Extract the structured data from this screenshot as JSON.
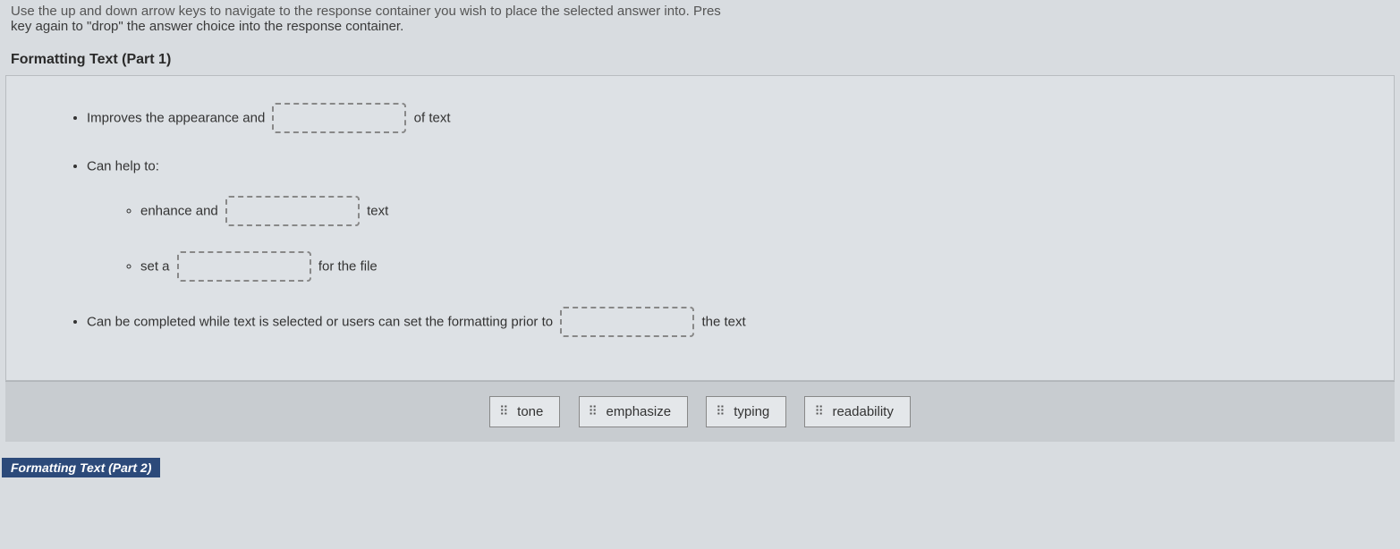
{
  "instructions": "key again to \"drop\" the answer choice into the response container.",
  "instructions_top_partial": "Use the up and down arrow keys to navigate to the response container you wish to place the selected answer into. Pres",
  "section_title": "Formatting Text (Part 1)",
  "bullets": {
    "b1_pre": "Improves the appearance and",
    "b1_post": "of text",
    "b2": "Can help to:",
    "b2a_pre": "enhance and",
    "b2a_post": "text",
    "b2b_pre": "set a",
    "b2b_post": "for the file",
    "b3_pre": "Can be completed while text is selected or users can set the formatting prior to",
    "b3_post": "the text"
  },
  "choices": [
    "tone",
    "emphasize",
    "typing",
    "readability"
  ],
  "footer": "Formatting Text (Part 2)"
}
